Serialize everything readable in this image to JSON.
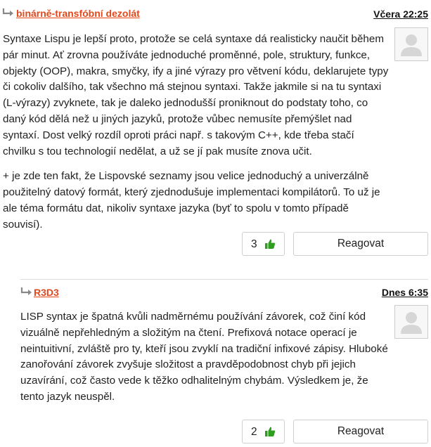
{
  "comments": [
    {
      "author": "binárně-transfóbní dezolát",
      "date": "Včera 22:25",
      "paragraphs": [
        "Syntaxe Lispu je lepší proto, protože se celá syntaxe dá realisticky naučit během pár minut. Ať zrovna používáte jednoduché proměnné, pole, struktury, funkce, objekty (OOP), makra, smyčky, ify a jiné výrazy pro větvení kódu, deklarujete typy či cokoliv dalšího, tak všechno má stejnou syntaxi. Takže jakmile si na tu syntaxi (L-výrazy) zvyknete, tak je daleko jednodušší proniknout do podstaty toho, co daný kód dělá než u jiných jazyků, protože vůbec nemusíte přemýšlet nad syntaxí. Dost velký rozdíl oproti práci např. s takovým C++, kde třeba stačí chvilku s tou technologií nedělat, a už se jí pak musíte znova učit.",
        "+ je zde ten fakt, že Lispovské seznamy jsou velice jednoduchý a univerzálně použitelný datový formát, který zjednodušuje implementaci kompilátorů. To už je ale téma formátu dat, nikoliv syntaxe jazyka (byť to spolu v tomto případě souvisí)."
      ],
      "likes": "3",
      "reply_label": "Reagovat"
    },
    {
      "author": "R3D3",
      "date": "Dnes 6:35",
      "paragraphs": [
        "LISP syntax je špatná kvůli nadměrnému používání závorek, což činí kód vizuálně nepřehledným a složitým na čtení. Prefixová notace operací je neintuitivní, zvláště pro ty, kteří jsou zvyklí na tradiční infixové zápisy. Hluboké zanořování závorek zvyšuje složitost a pravděpodobnost chyb při jejich uzavírání, což často vede k těžko odhalitelným chybám. Výsledkem je, že tento jazyk neuspěl."
      ],
      "likes": "2",
      "reply_label": "Reagovat"
    }
  ],
  "icons": {
    "reply_arrow": "reply-arrow-icon",
    "avatar": "default-avatar-icon",
    "like": "thumbs-up-icon"
  },
  "colors": {
    "author_link": "#e2481c",
    "like_icon": "#2f9e1f",
    "arrow": "#888888",
    "avatar_figure": "#d6d6d6"
  }
}
